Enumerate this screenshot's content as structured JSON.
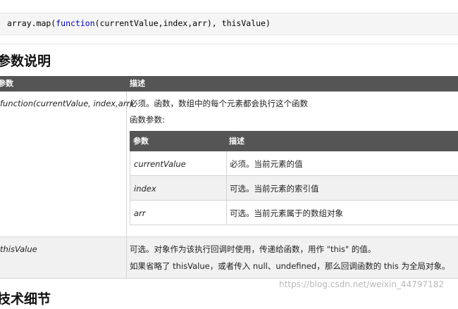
{
  "code": {
    "prefix": "array.map(",
    "keyword": "function",
    "suffix": "(currentValue,index,arr), thisValue)"
  },
  "section_title": "参数说明",
  "table": {
    "headers": [
      "参数",
      "描述"
    ],
    "rows": [
      {
        "param": "function(currentValue, index,arr)",
        "desc_lines": [
          "必须。函数，数组中的每个元素都会执行这个函数",
          "函数参数:"
        ]
      },
      {
        "param": "thisValue",
        "desc_lines": [
          "可选。对象作为该执行回调时使用，传递给函数，用作 \"this\" 的值。",
          "如果省略了 thisValue，或者传入 null、undefined，那么回调函数的 this 为全局对象。"
        ]
      }
    ]
  },
  "inner_table": {
    "headers": [
      "参数",
      "描述"
    ],
    "rows": [
      {
        "param": "currentValue",
        "desc": "必须。当前元素的值"
      },
      {
        "param": "index",
        "desc": "可选。当前元素的索引值"
      },
      {
        "param": "arr",
        "desc": "可选。当前元素属于的数组对象"
      }
    ]
  },
  "next_section_title": "技术细节",
  "watermark": "https://blog.csdn.net/weixin_44797182"
}
